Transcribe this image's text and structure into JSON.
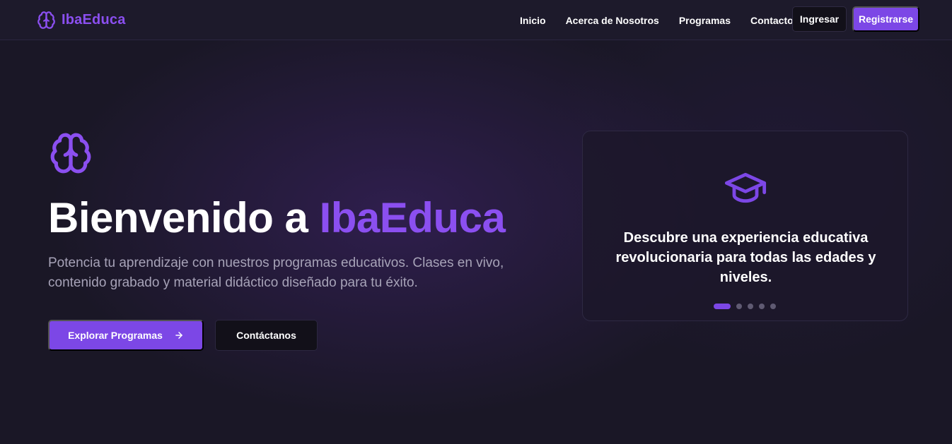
{
  "brand": {
    "name": "IbaEduca",
    "icon": "brain-icon",
    "accent_color": "#8b4ff0"
  },
  "nav": {
    "links": [
      {
        "label": "Inicio"
      },
      {
        "label": "Acerca de Nosotros"
      },
      {
        "label": "Programas"
      },
      {
        "label": "Contacto"
      }
    ],
    "login_label": "Ingresar",
    "register_label": "Registrarse"
  },
  "hero": {
    "icon": "brain-icon",
    "title_prefix": "Bienvenido a ",
    "title_accent": "IbaEduca",
    "subtitle": "Potencia tu aprendizaje con nuestros programas educativos. Clases en vivo, contenido grabado y material didáctico diseñado para tu éxito.",
    "primary_button": "Explorar Programas",
    "primary_button_icon": "arrow-right-icon",
    "secondary_button": "Contáctanos"
  },
  "carousel": {
    "icon": "graduation-cap-icon",
    "text": "Descubre una experiencia educativa revolucionaria para todas las edades y niveles.",
    "slide_count": 5,
    "active_slide": 1
  },
  "colors": {
    "primary": "#7c47e6",
    "background": "#1a1726",
    "muted_text": "#a7a3b8"
  }
}
